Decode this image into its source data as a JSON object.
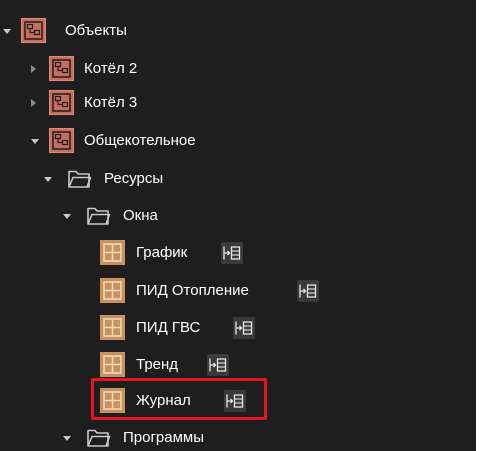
{
  "colors": {
    "background": "#1e1e1e",
    "object_icon": "#c86e5f",
    "window_icon": "#c8925f",
    "highlight": "#e8141e"
  },
  "tree": {
    "root": {
      "label": "Объекты",
      "icon": "objects-icon",
      "expanded": true
    },
    "items": [
      {
        "label": "Котёл 2",
        "icon": "object-icon",
        "expanded": false
      },
      {
        "label": "Котёл 3",
        "icon": "object-icon",
        "expanded": false
      },
      {
        "label": "Общекотельное",
        "icon": "object-icon",
        "expanded": true
      },
      {
        "label": "Ресурсы",
        "icon": "folder-icon",
        "expanded": true
      },
      {
        "label": "Окна",
        "icon": "folder-icon",
        "expanded": true
      },
      {
        "label": "График",
        "icon": "window-icon",
        "bind_icon": "bind-icon"
      },
      {
        "label": "ПИД Отопление",
        "icon": "window-icon",
        "bind_icon": "bind-icon"
      },
      {
        "label": "ПИД ГВС",
        "icon": "window-icon",
        "bind_icon": "bind-icon"
      },
      {
        "label": "Тренд",
        "icon": "window-icon",
        "bind_icon": "bind-icon"
      },
      {
        "label": "Журнал",
        "icon": "window-icon",
        "bind_icon": "bind-icon",
        "highlighted": true
      },
      {
        "label": "Программы",
        "icon": "folder-icon",
        "expanded": true
      }
    ]
  }
}
